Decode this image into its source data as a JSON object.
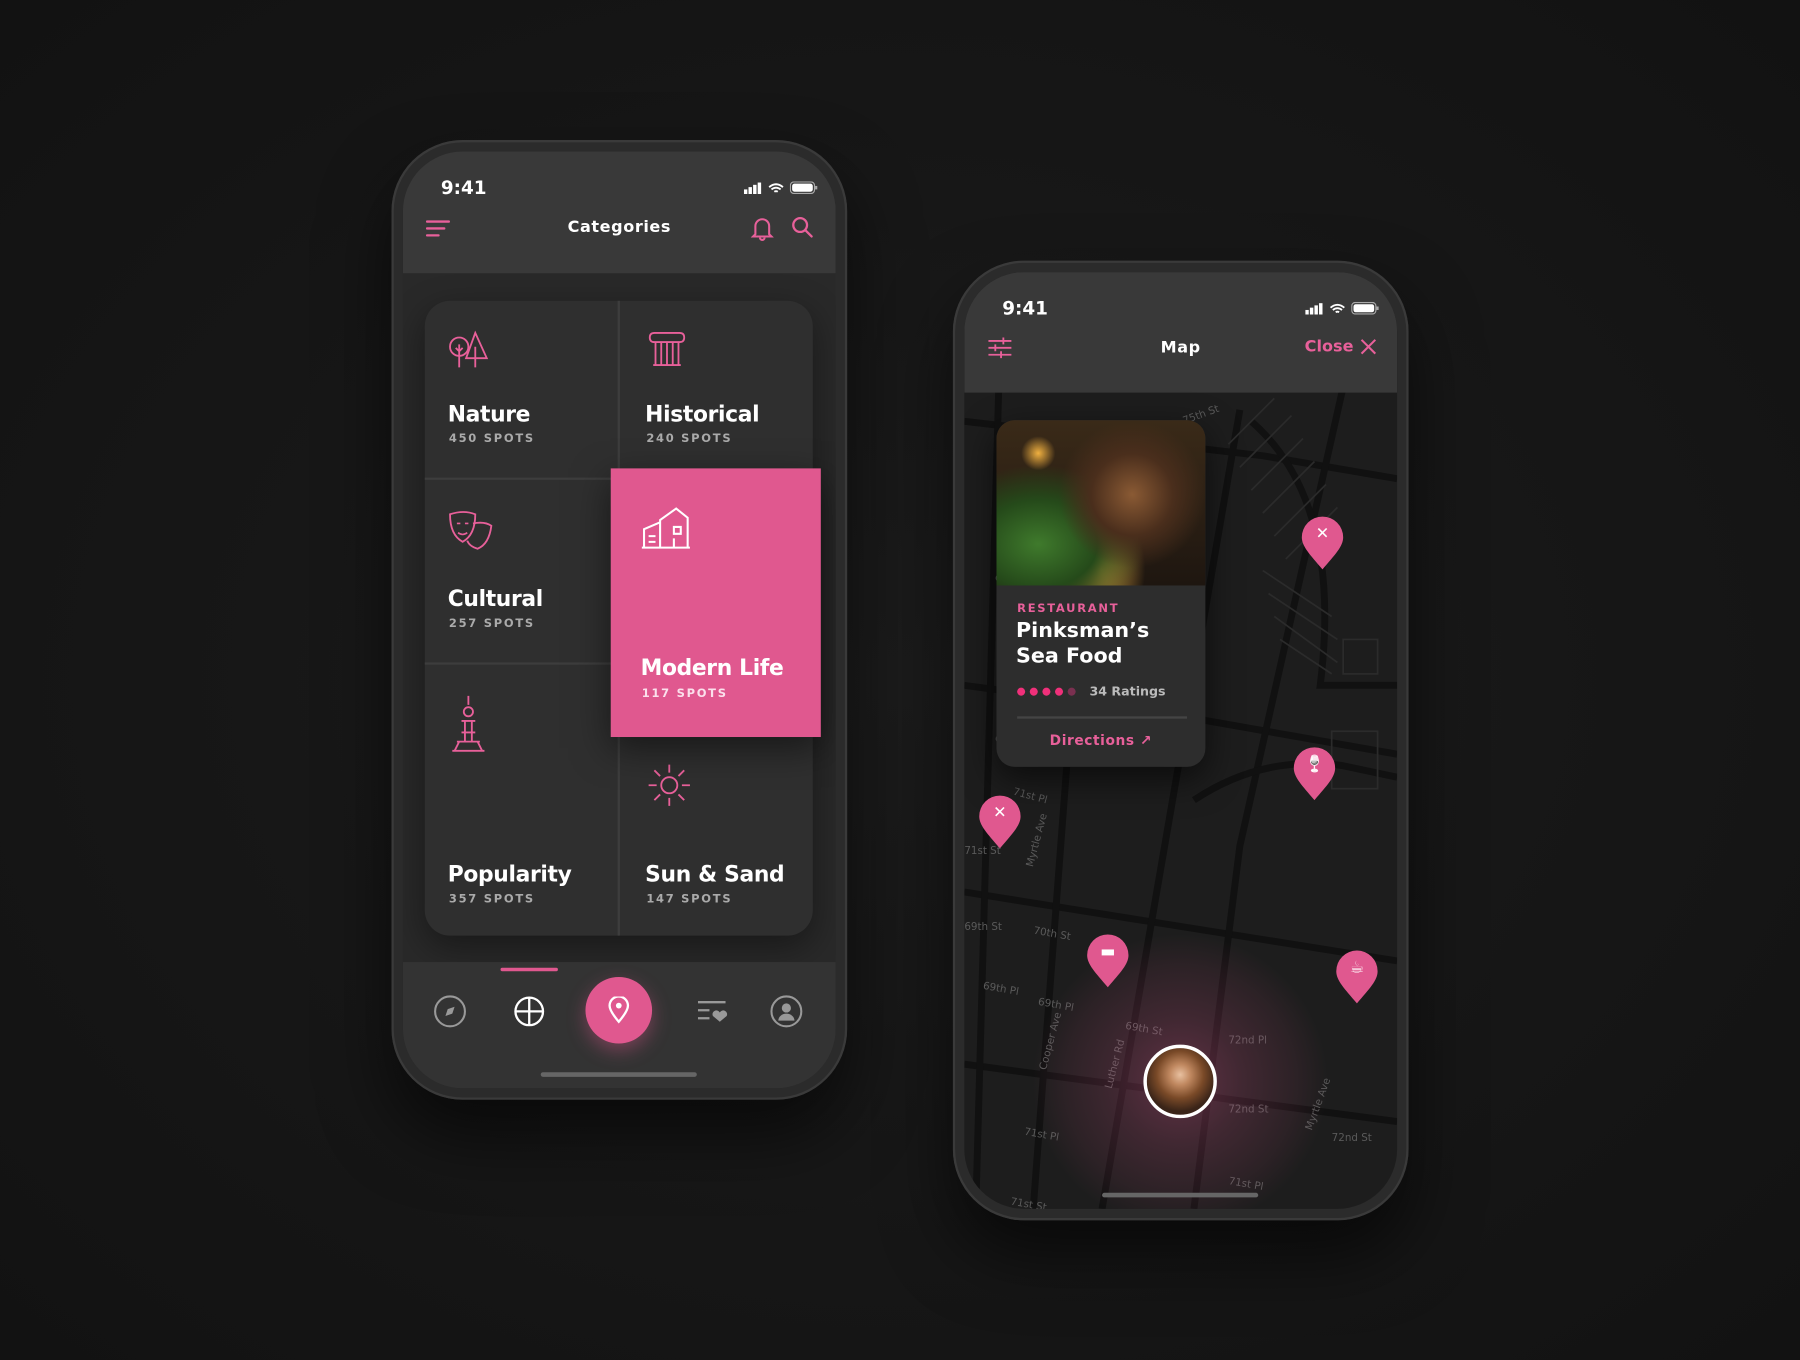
{
  "colors": {
    "accent": "#e0588f",
    "background": "#141414",
    "surface": "#2e2e2e"
  },
  "left_phone": {
    "status_time": "9:41",
    "header": {
      "title": "Categories",
      "menu_icon": "menu-icon",
      "bell_icon": "bell-icon",
      "search_icon": "search-icon"
    },
    "categories": [
      {
        "name": "Nature",
        "count": "450 SPOTS",
        "icon": "trees-icon"
      },
      {
        "name": "Historical",
        "count": "240 SPOTS",
        "icon": "column-icon"
      },
      {
        "name": "Cultural",
        "count": "257 SPOTS",
        "icon": "masks-icon"
      },
      {
        "name": "Modern Life",
        "count": "117 SPOTS",
        "icon": "buildings-icon",
        "selected": true
      },
      {
        "name": "Popularity",
        "count": "357 SPOTS",
        "icon": "tower-icon"
      },
      {
        "name": "Sun & Sand",
        "count": "147 SPOTS",
        "icon": "sun-icon"
      }
    ],
    "tabbar": [
      "compass-icon",
      "grid-icon",
      "location-pin-icon",
      "favorites-list-icon",
      "profile-icon"
    ],
    "active_tab": "grid-icon"
  },
  "right_phone": {
    "status_time": "9:41",
    "header": {
      "title": "Map",
      "close_label": "Close",
      "filter_icon": "sliders-icon"
    },
    "card": {
      "category": "RESTAURANT",
      "name_line1": "Pinksman’s",
      "name_line2": "Sea Food",
      "rating": 4,
      "rating_max": 5,
      "ratings_label": "34 Ratings",
      "directions_label": "Directions"
    },
    "pins": [
      "restaurant-icon",
      "bar-icon",
      "restaurant-icon",
      "hotel-icon",
      "cafe-icon"
    ],
    "streets": [
      "75th St",
      "Cooper Ave",
      "Cooper Ave",
      "71st Pl",
      "71st St",
      "Myrtle Ave",
      "70th St",
      "69th Pl",
      "69th Pl",
      "69th St",
      "Cooper Ave",
      "69th St",
      "Luther Rd",
      "72nd Pl",
      "72nd St",
      "71st Pl",
      "Myrtle Ave",
      "72nd St",
      "71st Pl",
      "71st St"
    ]
  }
}
